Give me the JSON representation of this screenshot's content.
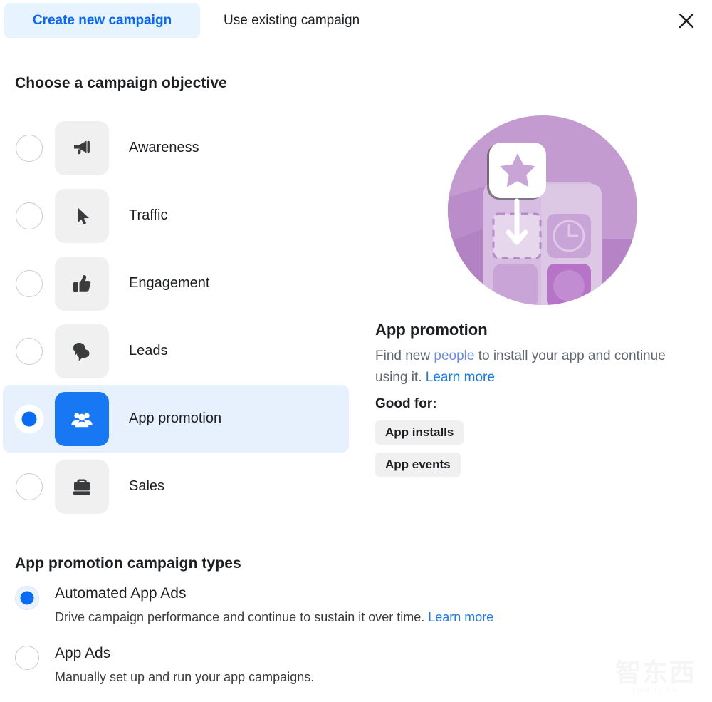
{
  "header": {
    "tabs": [
      {
        "label": "Create new campaign",
        "active": true
      },
      {
        "label": "Use existing campaign",
        "active": false
      }
    ],
    "close_icon": "close-icon"
  },
  "objective_section": {
    "heading": "Choose a campaign objective",
    "items": [
      {
        "label": "Awareness",
        "icon": "megaphone-icon",
        "selected": false
      },
      {
        "label": "Traffic",
        "icon": "cursor-icon",
        "selected": false
      },
      {
        "label": "Engagement",
        "icon": "thumbs-up-icon",
        "selected": false
      },
      {
        "label": "Leads",
        "icon": "chat-bubbles-icon",
        "selected": false
      },
      {
        "label": "App promotion",
        "icon": "people-icon",
        "selected": true
      },
      {
        "label": "Sales",
        "icon": "briefcase-icon",
        "selected": false
      }
    ]
  },
  "detail": {
    "illustration": "app-promotion-illustration",
    "title": "App promotion",
    "desc_part1": "Find new ",
    "desc_link_soft": "people",
    "desc_part2": " to install your app and continue using it. ",
    "desc_learn_more": "Learn more",
    "good_for_label": "Good for:",
    "tags": [
      "App installs",
      "App events"
    ]
  },
  "types_section": {
    "heading": "App promotion campaign types",
    "options": [
      {
        "title": "Automated App Ads",
        "desc": "Drive campaign performance and continue to sustain it over time. ",
        "learn_more": "Learn more",
        "selected": true
      },
      {
        "title": "App Ads",
        "desc": "Manually set up and run your app campaigns.",
        "learn_more": "",
        "selected": false
      }
    ]
  },
  "watermark": {
    "main": "智东西",
    "sub": "ZHIDXCOM"
  },
  "colors": {
    "accent_blue": "#1877f2",
    "link_blue": "#0866ff",
    "tab_bg": "#e7f3ff",
    "row_selected_bg": "#e7f0fd",
    "tile_gray": "#f0f0f0",
    "text_primary": "#1c1e21",
    "text_secondary": "#606770",
    "illustration_purple": "#b98fc6"
  }
}
